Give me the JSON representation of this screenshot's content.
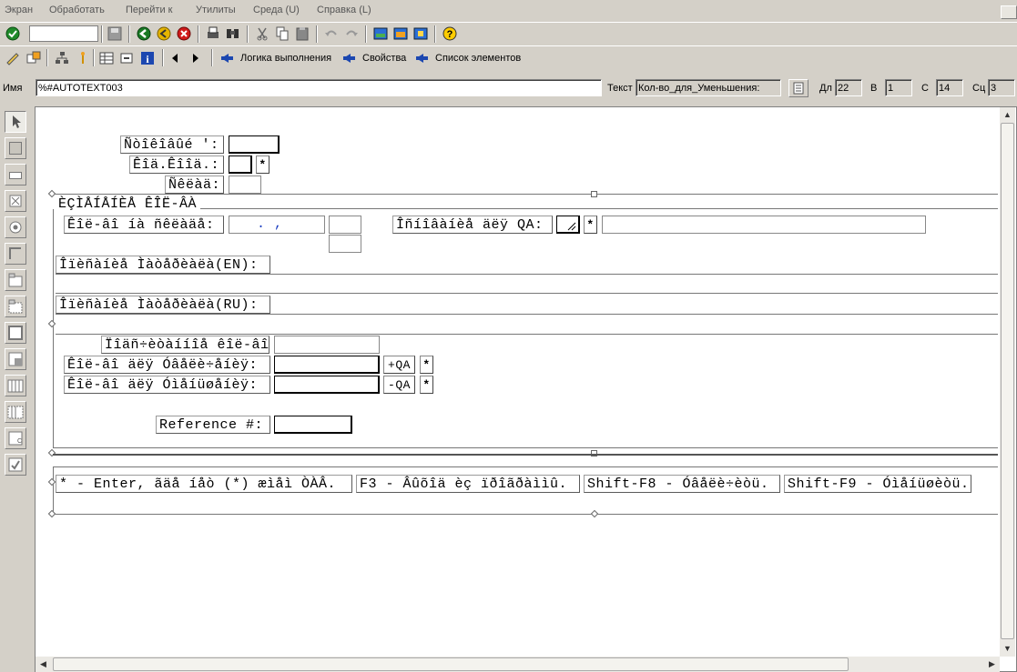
{
  "menu": [
    "Экран",
    "Обработать",
    "Перейти к",
    "Утилиты",
    "Среда (U)",
    "Справка (L)"
  ],
  "toolbar2": {
    "flow_logic": "Логика выполнения",
    "properties": "Свойства",
    "element_list": "Список элементов"
  },
  "props": {
    "name_label": "Имя",
    "name_value": "%#AUTOTEXT003",
    "text_label": "Текст",
    "text_value": "Кол-во_для_Уменьшения:",
    "len_label": "Дл",
    "len_value": "22",
    "line_label": "В",
    "line_value": "1",
    "col_label": "С",
    "col_value": "14",
    "sc_label": "Сц",
    "sc_value": "3"
  },
  "screen": {
    "warehouse_label": "Ñòîêîâûé ':",
    "cell_label": "Êîä.Êîîä.:",
    "store_label": "Ñêëàä:",
    "group_title": "ÈÇÌÅÍÅÍÈÅ ÊÎË-ÂÀ",
    "qty_label": "Êîë-âî íà ñêëàäå:",
    "qty_value": ".     ,",
    "reason_label": "Îñíîâàíèå äëÿ QA:",
    "desc_en_label": "Îïèñàíèå Ìàòåðèàëà(EN):",
    "desc_ru_label": "Îïèñàíèå Ìàòåðèàëà(RU):",
    "counted_label": "Ïîäñ÷èòàííîå êîë-âî:",
    "inc_label": "Êîë-âî äëÿ Óâåëè÷åíèÿ:",
    "dec_label": "Êîë-âî äëÿ Óìåíüøåíèÿ:",
    "plus_qa": "+QA",
    "minus_qa": "-QA",
    "star": "*",
    "ref_label": "Reference #:",
    "hint1": "* - Enter, ãäå íåò (*) æìåì ÒÀÂ.",
    "hint2": "F3 - Âûõîä èç ïðîãðàììû.",
    "hint3": "Shift-F8 - Óâåëè÷èòü.",
    "hint4": "Shift-F9 - Óìåíüøèòü."
  }
}
